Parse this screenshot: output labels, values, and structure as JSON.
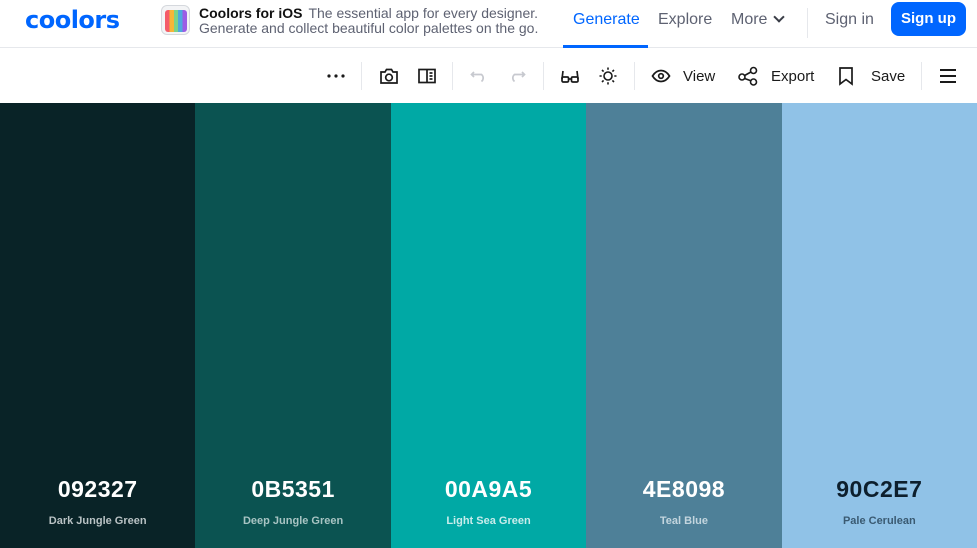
{
  "brand": {
    "logo_text": "coolors",
    "logo_color": "#0066ff"
  },
  "promo": {
    "title": "Coolors for iOS",
    "tagline": "The essential app for every designer.",
    "subtitle": "Generate and collect beautiful color palettes on the go."
  },
  "nav": {
    "generate": "Generate",
    "explore": "Explore",
    "more": "More",
    "sign_in": "Sign in",
    "sign_up": "Sign up",
    "accent": "#0066ff"
  },
  "toolbar": {
    "more_options_icon": "more-options-icon",
    "camera_icon": "camera-icon",
    "split_view_icon": "split-view-icon",
    "undo_icon": "undo-icon",
    "redo_icon": "redo-icon",
    "glasses_icon": "glasses-icon",
    "brightness_icon": "brightness-icon",
    "view_label": "View",
    "export_label": "Export",
    "save_label": "Save",
    "menu_icon": "hamburger-menu-icon"
  },
  "palette": {
    "colors": [
      {
        "hex": "092327",
        "name": "Dark Jungle Green",
        "bg": "#092327",
        "text": "#ffffff",
        "name_color": "#b9c2c4"
      },
      {
        "hex": "0B5351",
        "name": "Deep Jungle Green",
        "bg": "#0b5351",
        "text": "#ffffff",
        "name_color": "#a8c4c3"
      },
      {
        "hex": "00A9A5",
        "name": "Light Sea Green",
        "bg": "#00a9a5",
        "text": "#ffffff",
        "name_color": "#c8eceb"
      },
      {
        "hex": "4E8098",
        "name": "Teal Blue",
        "bg": "#4e8098",
        "text": "#ffffff",
        "name_color": "#c3d5de"
      },
      {
        "hex": "90C2E7",
        "name": "Pale Cerulean",
        "bg": "#90c2e7",
        "text": "#0d1f2d",
        "name_color": "#3a5a72"
      }
    ]
  }
}
